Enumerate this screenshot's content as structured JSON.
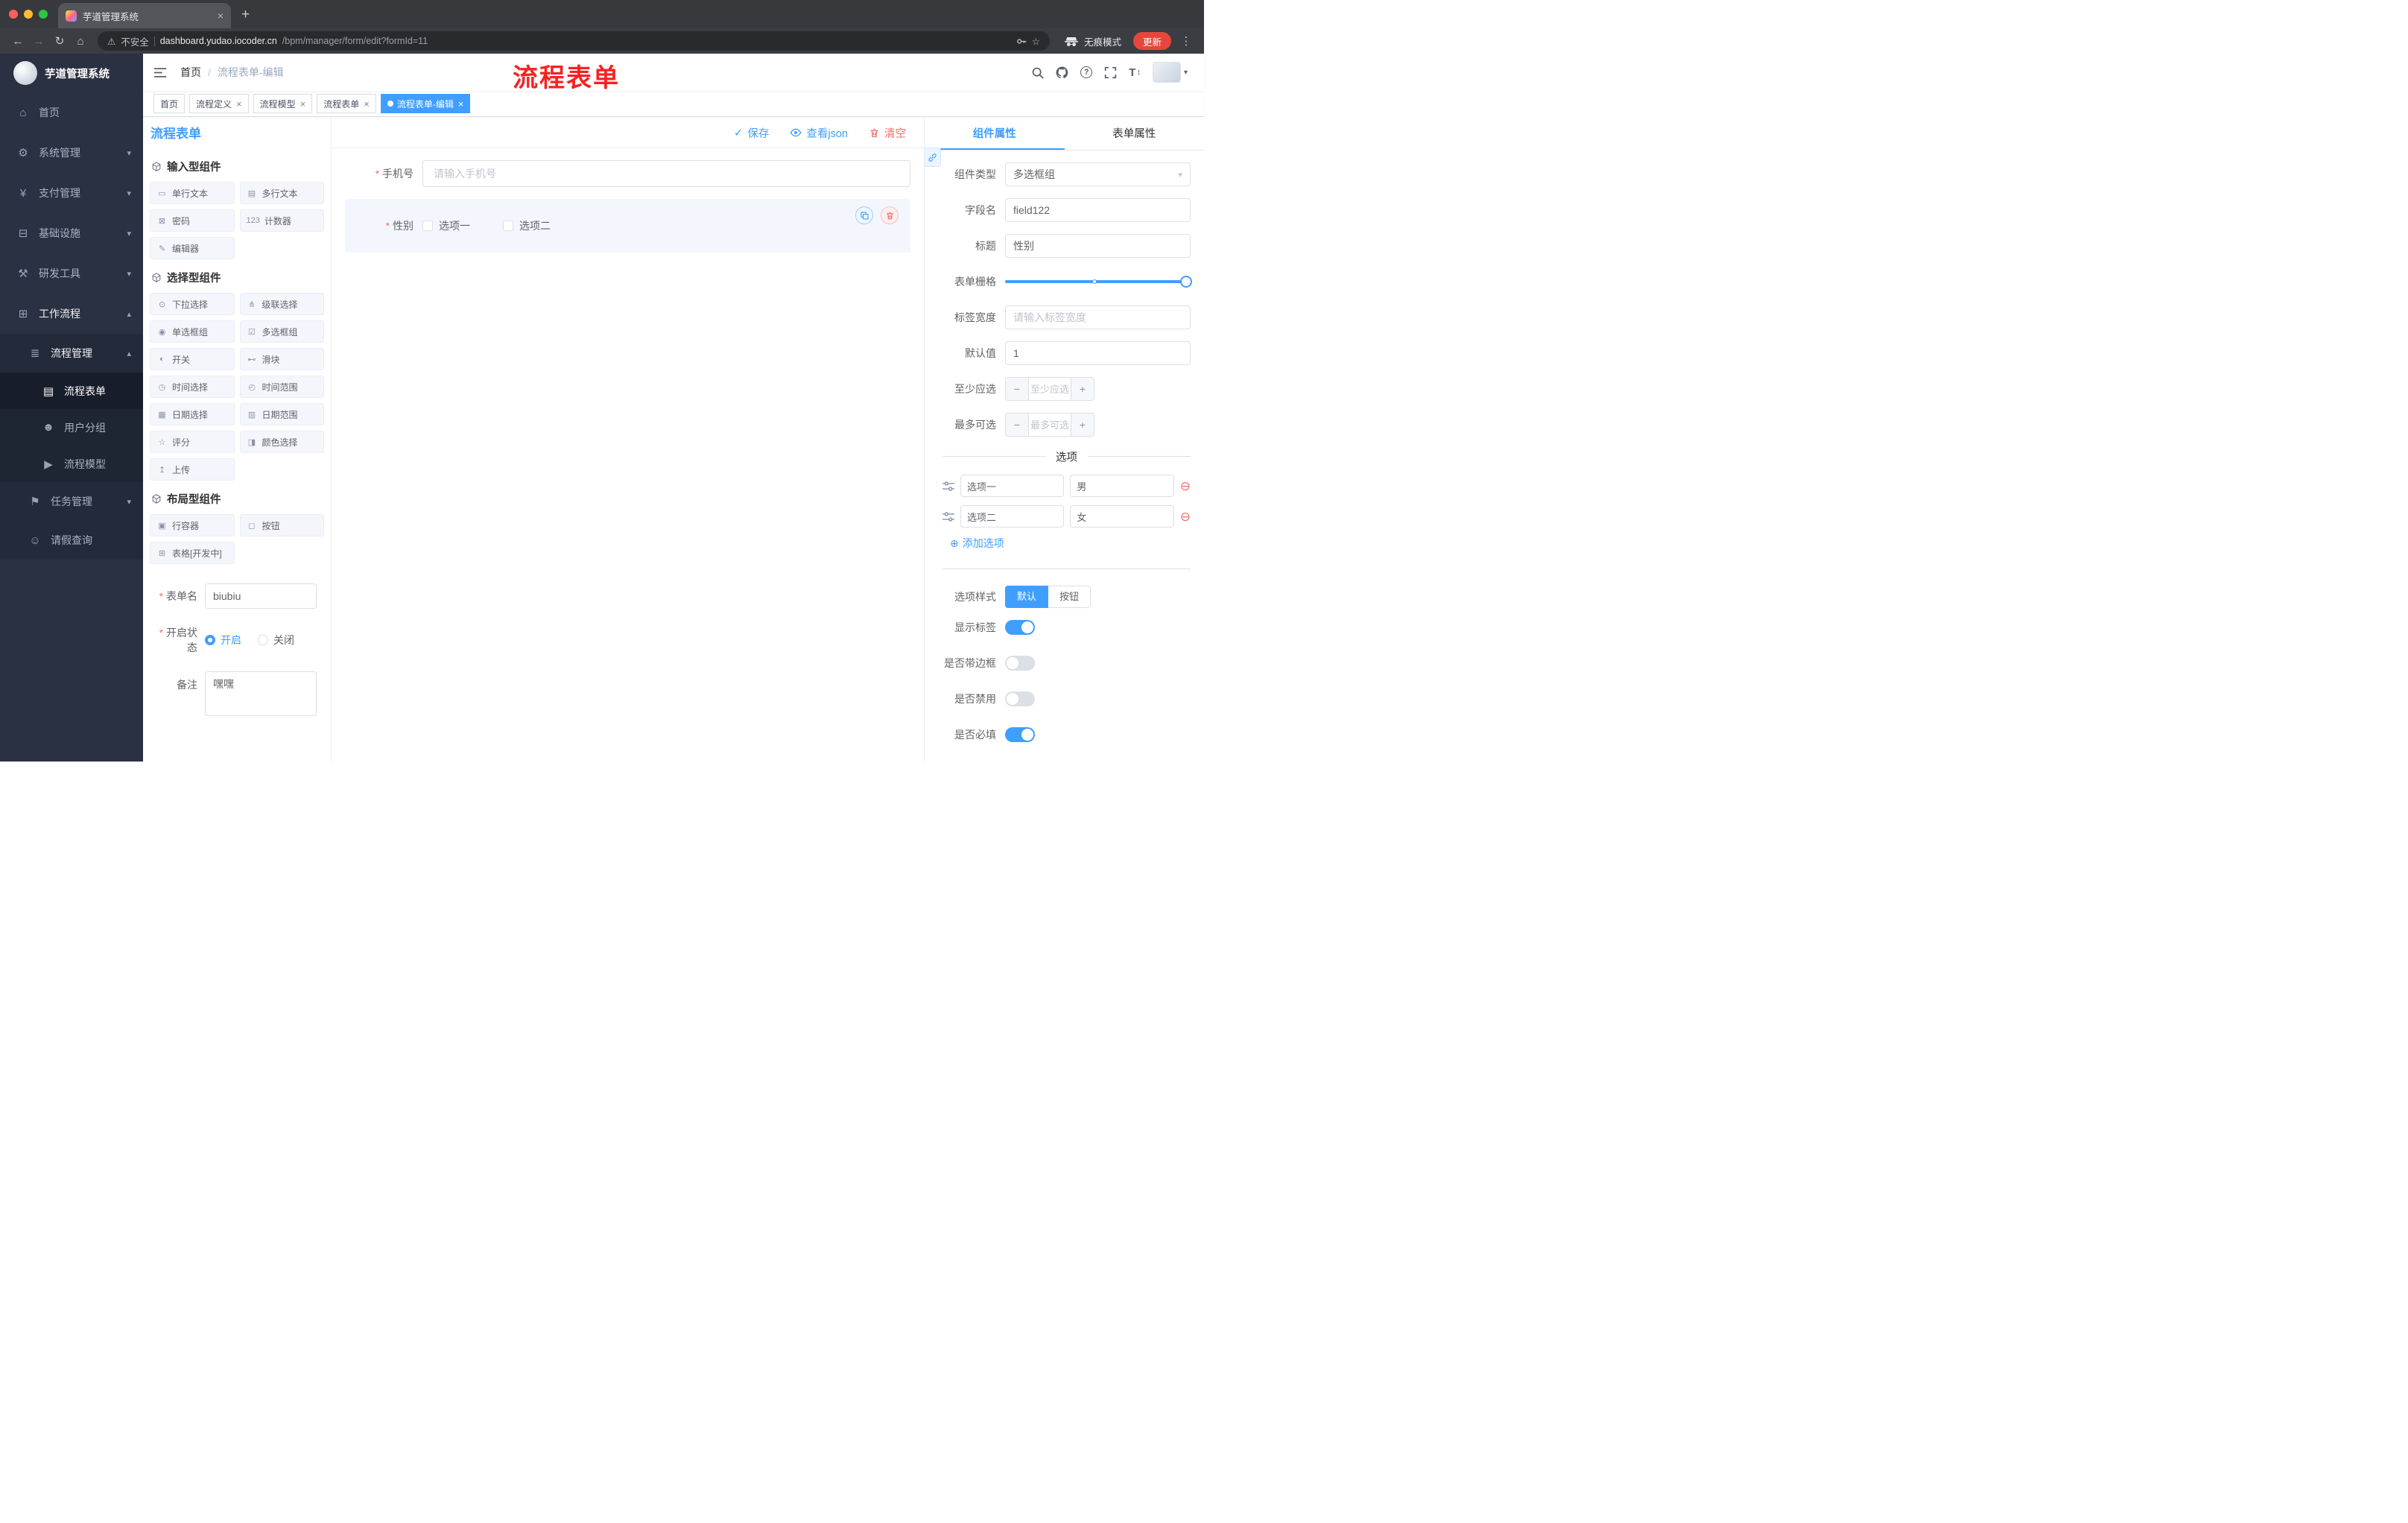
{
  "colors": {
    "accent": "#409eff",
    "danger": "#f56c6c",
    "annotation": "#f52222",
    "sidebar_bg": "#2a3142"
  },
  "glyphs": {
    "close": "×",
    "plus": "+",
    "minus": "−",
    "back": "←",
    "forward": "→",
    "reload": "↻",
    "home": "⌂",
    "warning": "⚠",
    "star": "☆",
    "dots": "⋮",
    "caret_down": "▾",
    "caret_up": "▴",
    "check": "✓",
    "question": "?",
    "font_size": "T",
    "arrows_v": "↕",
    "dot": "●",
    "add_circle": "⊕",
    "remove_circle": "⊖",
    "slash": "/"
  },
  "browser": {
    "tab_title": "芋道管理系统",
    "security": "不安全",
    "url_host": "dashboard.yudao.iocoder.cn",
    "url_path": "/bpm/manager/form/edit?formId=11",
    "incognito": "无痕模式",
    "update": "更新"
  },
  "sidebar": {
    "logo_title": "芋道管理系统",
    "items": [
      {
        "label": "首页",
        "icon": "⌂",
        "arrow": ""
      },
      {
        "label": "系统管理",
        "icon": "⚙",
        "arrow": "▾"
      },
      {
        "label": "支付管理",
        "icon": "¥",
        "arrow": "▾"
      },
      {
        "label": "基础设施",
        "icon": "⊟",
        "arrow": "▾"
      },
      {
        "label": "研发工具",
        "icon": "⚒",
        "arrow": "▾"
      },
      {
        "label": "工作流程",
        "icon": "⊞",
        "arrow": "▴"
      }
    ],
    "submenu": {
      "label": "流程管理",
      "icon": "≣",
      "arrow": "▴"
    },
    "children": [
      {
        "label": "流程表单",
        "icon": "▤"
      },
      {
        "label": "用户分组",
        "icon": "☻"
      },
      {
        "label": "流程模型",
        "icon": "▶"
      }
    ],
    "tail": [
      {
        "label": "任务管理",
        "icon": "⚑",
        "arrow": "▾"
      },
      {
        "label": "请假查询",
        "icon": "☺",
        "arrow": ""
      }
    ]
  },
  "header": {
    "breadcrumb_home": "首页",
    "breadcrumb_current": "流程表单-编辑",
    "annotation": "流程表单"
  },
  "tags": [
    {
      "label": "首页"
    },
    {
      "label": "流程定义"
    },
    {
      "label": "流程模型"
    },
    {
      "label": "流程表单"
    },
    {
      "label": "流程表单-编辑"
    }
  ],
  "designer": {
    "title": "流程表单",
    "toolbar": {
      "save": "保存",
      "view_json": "查看json",
      "clear": "清空"
    },
    "groups": [
      {
        "title": "输入型组件",
        "items": [
          {
            "label": "单行文本",
            "icon": "▭"
          },
          {
            "label": "多行文本",
            "icon": "▤"
          },
          {
            "label": "密码",
            "icon": "⊠"
          },
          {
            "label": "计数器",
            "icon": "123"
          },
          {
            "label": "编辑器",
            "icon": "✎"
          }
        ]
      },
      {
        "title": "选择型组件",
        "items": [
          {
            "label": "下拉选择",
            "icon": "⊙"
          },
          {
            "label": "级联选择",
            "icon": "⋔"
          },
          {
            "label": "单选框组",
            "icon": "◉"
          },
          {
            "label": "多选框组",
            "icon": "☑"
          },
          {
            "label": "开关",
            "icon": "◐"
          },
          {
            "label": "滑块",
            "icon": "⊷"
          },
          {
            "label": "时间选择",
            "icon": "◷"
          },
          {
            "label": "时间范围",
            "icon": "◴"
          },
          {
            "label": "日期选择",
            "icon": "▦"
          },
          {
            "label": "日期范围",
            "icon": "▥"
          },
          {
            "label": "评分",
            "icon": "☆"
          },
          {
            "label": "颜色选择",
            "icon": "◨"
          },
          {
            "label": "上传",
            "icon": "↥"
          }
        ]
      },
      {
        "title": "布局型组件",
        "items": [
          {
            "label": "行容器",
            "icon": "▣"
          },
          {
            "label": "按钮",
            "icon": "◻"
          },
          {
            "label": "表格[开发中]",
            "icon": "⊞"
          }
        ]
      }
    ],
    "meta": {
      "name_label": "表单名",
      "name_value": "biubiu",
      "status_label": "开启状态",
      "status_on": "开启",
      "status_off": "关闭",
      "remark_label": "备注",
      "remark_value": "嘿嘿"
    },
    "canvas": {
      "phone_label": "手机号",
      "phone_placeholder": "请输入手机号",
      "gender_label": "性别",
      "gender_options": [
        {
          "label": "选项一"
        },
        {
          "label": "选项二"
        }
      ]
    }
  },
  "props": {
    "tab_component": "组件属性",
    "tab_form": "表单属性",
    "type_label": "组件类型",
    "type_value": "多选框组",
    "field_label": "字段名",
    "field_value": "field122",
    "title_label": "标题",
    "title_value": "性别",
    "grid_label": "表单栅格",
    "label_width_label": "标签宽度",
    "label_width_placeholder": "请输入标签宽度",
    "default_label": "默认值",
    "default_value": "1",
    "min_label": "至少应选",
    "min_placeholder": "至少应选",
    "max_label": "最多可选",
    "max_placeholder": "最多可选",
    "options_title": "选项",
    "options": [
      {
        "name": "选项一",
        "value": "男"
      },
      {
        "name": "选项二",
        "value": "女"
      }
    ],
    "add_option": "添加选项",
    "style_label": "选项样式",
    "style_default": "默认",
    "style_button": "按钮",
    "show_label_label": "显示标签",
    "border_label": "是否带边框",
    "disabled_label": "是否禁用",
    "required_label": "是否必填"
  }
}
